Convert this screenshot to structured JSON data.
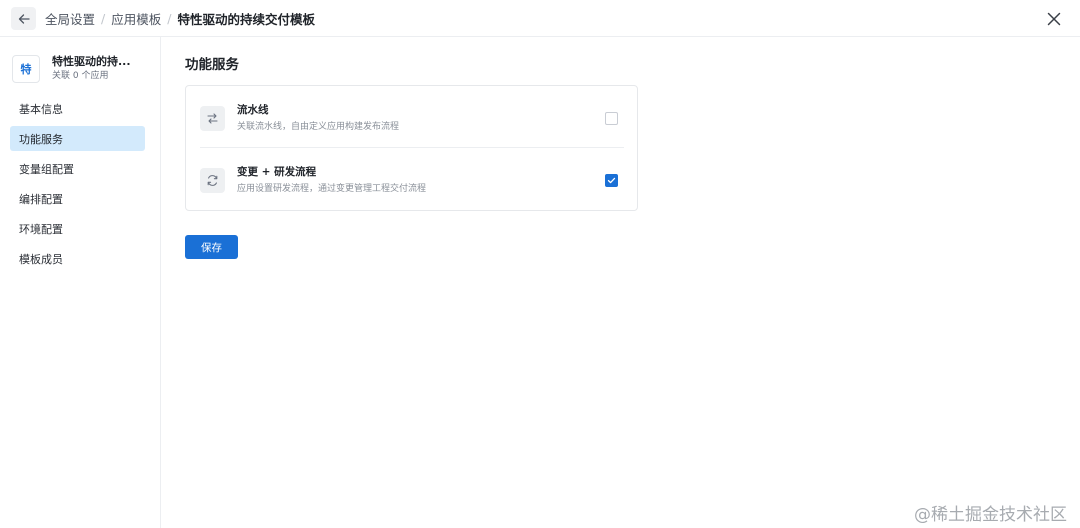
{
  "header": {
    "breadcrumbs": [
      "全局设置",
      "应用模板",
      "特性驱动的持续交付模板"
    ],
    "separator": "/"
  },
  "sidebar": {
    "app": {
      "avatar_text": "特",
      "name": "特性驱动的持...",
      "subtitle": "关联 0 个应用"
    },
    "items": [
      {
        "label": "基本信息",
        "active": false
      },
      {
        "label": "功能服务",
        "active": true
      },
      {
        "label": "变量组配置",
        "active": false
      },
      {
        "label": "编排配置",
        "active": false
      },
      {
        "label": "环境配置",
        "active": false
      },
      {
        "label": "模板成员",
        "active": false
      }
    ]
  },
  "main": {
    "title": "功能服务",
    "services": [
      {
        "title": "流水线",
        "desc": "关联流水线，自由定义应用构建发布流程",
        "checked": false,
        "icon": "pipeline-icon"
      },
      {
        "title": "变更 + 研发流程",
        "desc": "应用设置研发流程，通过变更管理工程交付流程",
        "checked": true,
        "icon": "workflow-icon"
      }
    ],
    "save_label": "保存"
  },
  "watermark": "@稀土掘金技术社区",
  "colors": {
    "primary": "#1a70d6",
    "active_nav_bg": "#d3eafc",
    "border": "#e6e8eb"
  }
}
